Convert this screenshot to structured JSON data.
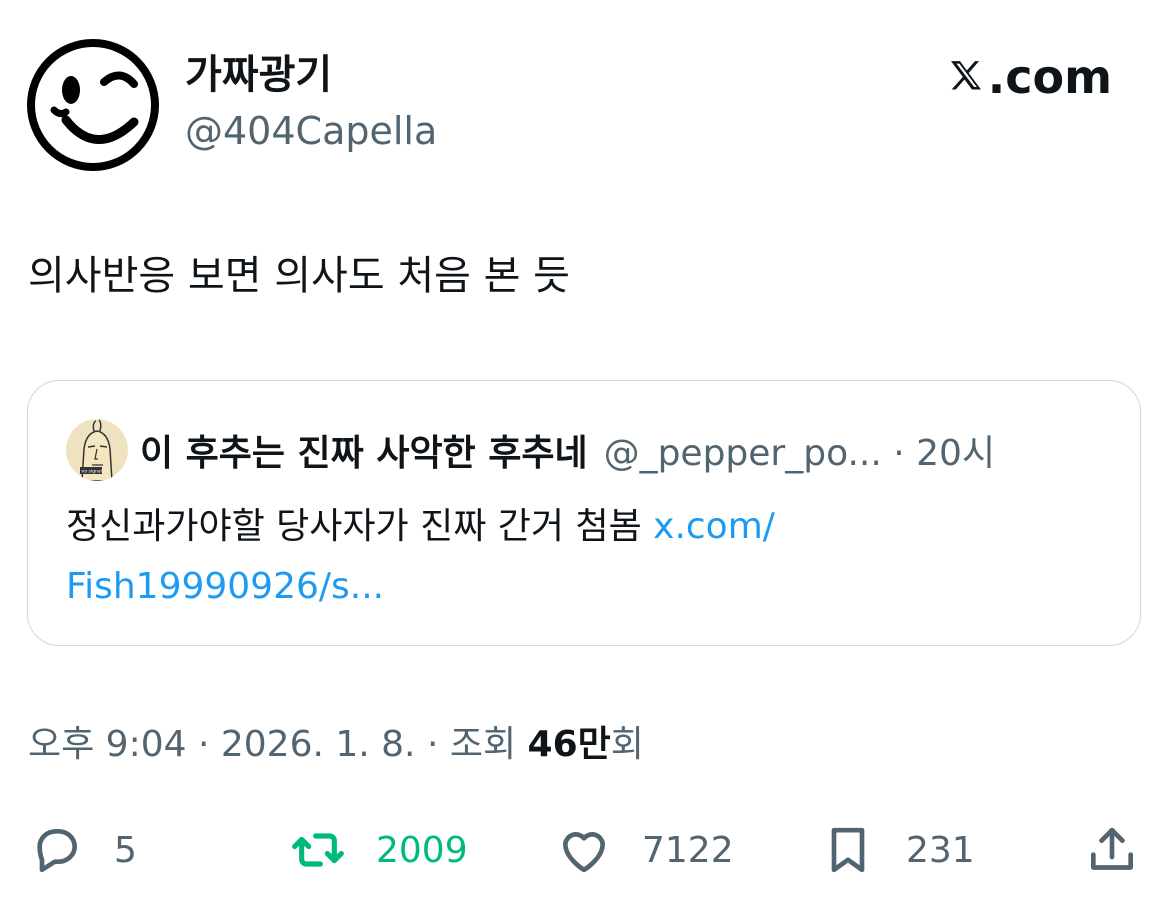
{
  "author": {
    "name": "가짜광기",
    "handle": "@404Capella"
  },
  "brand": {
    "label": ".com"
  },
  "tweet": {
    "text": "의사반응 보면 의사도 처음 본 듯"
  },
  "quote": {
    "name": "이 후추는 진짜 사악한 후추네",
    "handle": "@_pepper_po... · 20시",
    "avatar_label": "no signal",
    "body_text": "정신과가야할 당사자가 진짜 간거 첨봄 ",
    "link_line1": "x.com/",
    "link_line2": "Fish19990926/s..."
  },
  "meta": {
    "time": "오후 9:04 · 2026. 1. 8. · 조회 ",
    "views": "46만",
    "views_suffix": "회"
  },
  "actions": {
    "replies": "5",
    "retweets": "2009",
    "likes": "7122",
    "bookmarks": "231"
  },
  "colors": {
    "text": "#0f1419",
    "secondary": "#536471",
    "link": "#1d9bf0",
    "retweet": "#00ba7c",
    "border": "#cfd9de"
  },
  "icons": {
    "avatar": "winking-face-icon",
    "brand": "x-logo-icon",
    "reply": "reply-icon",
    "retweet": "retweet-icon",
    "like": "heart-icon",
    "bookmark": "bookmark-icon",
    "share": "share-icon"
  }
}
